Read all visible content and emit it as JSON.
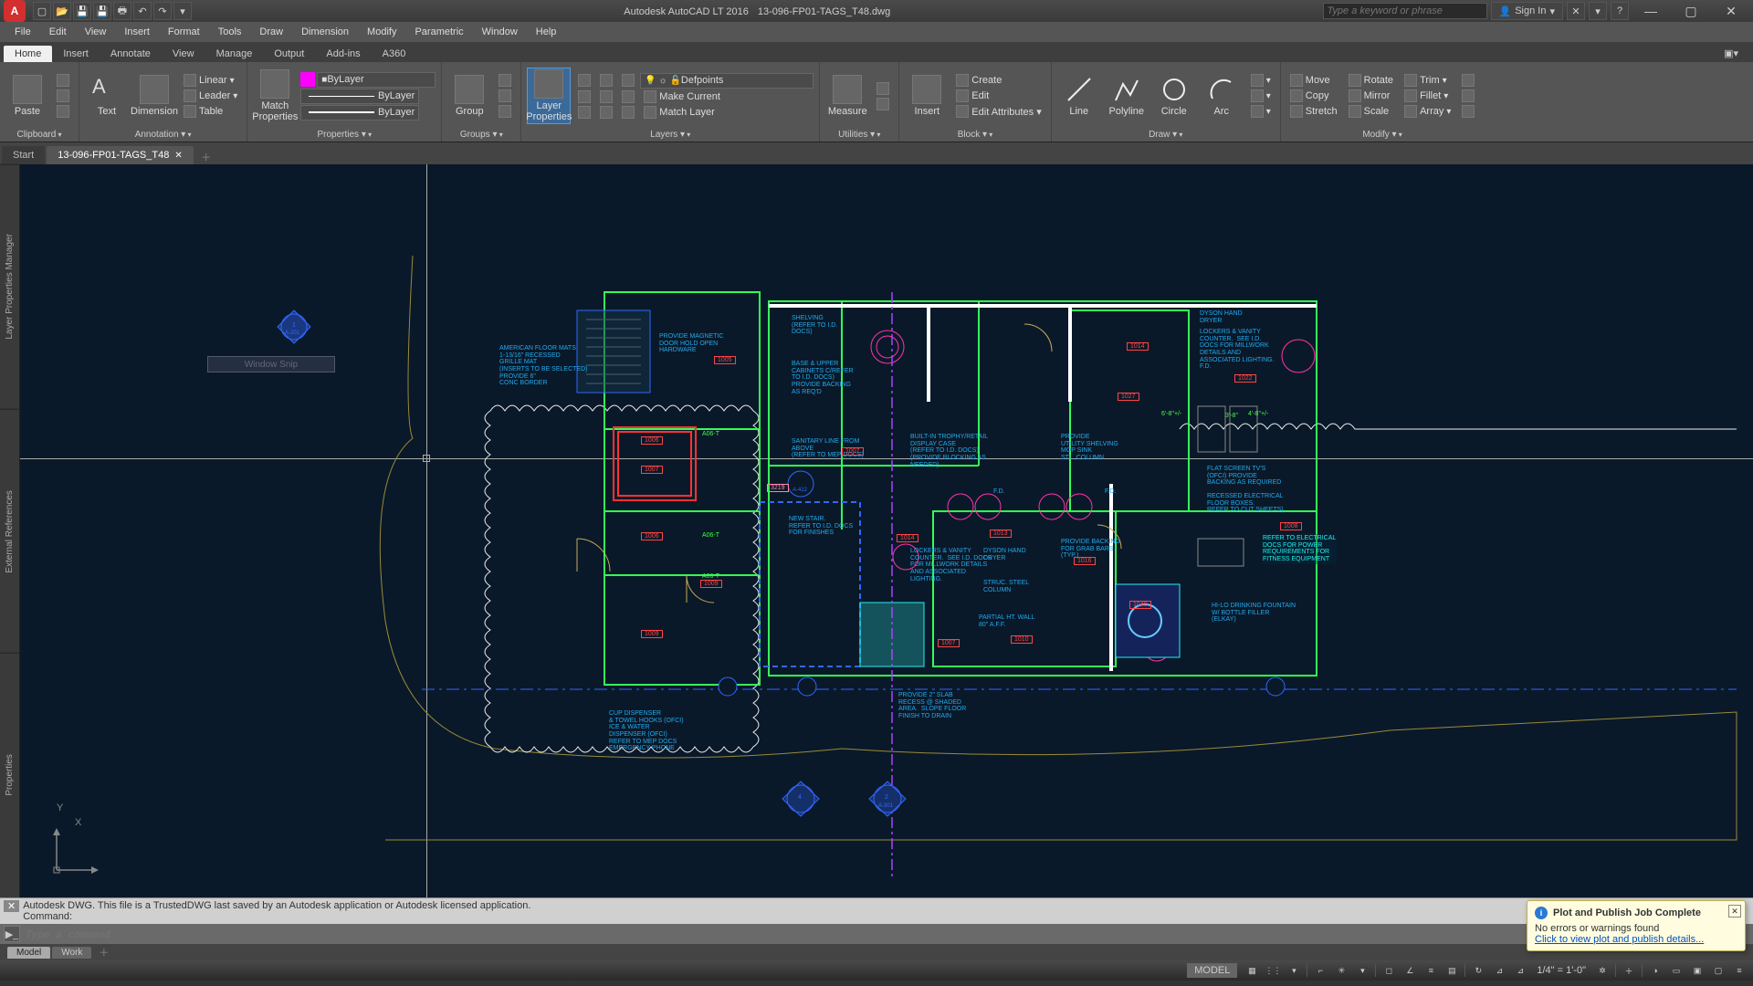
{
  "title": {
    "app": "Autodesk AutoCAD LT 2016",
    "file": "13-096-FP01-TAGS_T48.dwg"
  },
  "search": {
    "placeholder": "Type a keyword or phrase"
  },
  "signin": {
    "label": "Sign In"
  },
  "menus": [
    "File",
    "Edit",
    "View",
    "Insert",
    "Format",
    "Tools",
    "Draw",
    "Dimension",
    "Modify",
    "Parametric",
    "Window",
    "Help"
  ],
  "tabs": [
    "Home",
    "Insert",
    "Annotate",
    "View",
    "Manage",
    "Output",
    "Add-ins",
    "A360"
  ],
  "panels": {
    "clipboard": {
      "title": "Clipboard",
      "paste": "Paste"
    },
    "annotation": {
      "title": "Annotation ▾",
      "text": "Text",
      "dim": "Dimension",
      "linear": "Linear",
      "leader": "Leader",
      "table": "Table"
    },
    "props": {
      "title": "Properties ▾",
      "match": "Match\nProperties",
      "layer_sel": "ByLayer",
      "lt_sel": "ByLayer",
      "lw_sel": "ByLayer"
    },
    "groups": {
      "title": "Groups ▾",
      "group": "Group"
    },
    "layers": {
      "title": "Layers ▾",
      "layerprops": "Layer\nProperties",
      "current": "Defpoints",
      "makecur": "Make Current",
      "matchlayer": "Match Layer"
    },
    "utilities": {
      "title": "Utilities ▾",
      "measure": "Measure"
    },
    "block": {
      "title": "Block ▾",
      "insert": "Insert",
      "create": "Create",
      "edit": "Edit",
      "editattr": "Edit Attributes ▾"
    },
    "draw": {
      "title": "Draw ▾",
      "line": "Line",
      "polyline": "Polyline",
      "circle": "Circle",
      "arc": "Arc"
    },
    "modify": {
      "title": "Modify ▾",
      "move": "Move",
      "copy": "Copy",
      "stretch": "Stretch",
      "rotate": "Rotate",
      "mirror": "Mirror",
      "scale": "Scale",
      "trim": "Trim",
      "fillet": "Fillet",
      "array": "Array"
    }
  },
  "filetabs": {
    "start": "Start",
    "active": "13-096-FP01-TAGS_T48"
  },
  "side": [
    "Layer Properties Manager",
    "External References",
    "Properties"
  ],
  "snip": "Window Snip",
  "cmd": {
    "history": "Autodesk DWG.  This file is a TrustedDWG last saved by an Autodesk application or Autodesk licensed application.\nCommand:",
    "prompt": "Type a command"
  },
  "notify": {
    "title": "Plot and Publish Job Complete",
    "body": "No errors or warnings found",
    "link": "Click to view plot and publish details..."
  },
  "modeltabs": [
    "Model",
    "Work"
  ],
  "status": {
    "model": "MODEL",
    "scale": "1/4\" = 1'-0\""
  },
  "annotations": {
    "a1": "PROVIDE MAGNETIC\nDOOR HOLD OPEN\nHARDWARE",
    "a2": "AMERICAN FLOOR MATS\n1-13/16\" RECESSED\nGRILLE MAT\n(INSERTS TO BE SELECTED)\nPROVIDE 6\"\nCONC BORDER",
    "a3": "SHELVING\n(REFER TO I.D.\nDOCS)",
    "a4": "BASE & UPPER\nCABINETS C/REFER\nTO I.D. DOCS)\nPROVIDE BACKING\nAS REQ'D",
    "a5": "SANITARY LINE FROM\nABOVE\n(REFER TO MEP DOCS)",
    "a6": "BUILT-IN TROPHY/RETAIL\nDISPLAY CASE\n(REFER TO I.D. DOCS)\n(PROVIDE BLOCKING AS\nNEEDED)",
    "a7": "NEW STAIR.\nREFER TO I.D. DOCS\nFOR FINISHES",
    "a8": "CUP DISPENSER\n& TOWEL HOOKS (OFCI)\nICE & WATER\nDISPENSER (OFCI)\nREFER TO MEP DOCS\nEMERGENCY PHONE",
    "a9": "PROVIDE 2\" SLAB\nRECESS @ SHADED\nAREA.  SLOPE FLOOR\nFINISH TO DRAIN",
    "a10": "LOCKERS & VANITY\nCOUNTER.  SEE I.D. DOCS\nFOR MILLWORK DETAILS\nAND ASSOCIATED\nLIGHTING.",
    "a11": "DYSON HAND\nDRYER",
    "a12": "STRUC. STEEL\nCOLUMN",
    "a13": "PARTIAL HT. WALL\n80\" A.F.F.",
    "a14": "PROVIDE\nUTILITY SHELVING\nMOP SINK\nSTL. COLUMN",
    "a15": "PROVIDE BACKING\nFOR GRAB BARS\n(TYP.)",
    "a16": "DYSON HAND\nDRYER",
    "a17": "LOCKERS & VANITY\nCOUNTER.  SEE I.D.\nDOCS FOR MILLWORK\nDETAILS AND\nASSOCIATED LIGHTING.\nF.D.",
    "a18": "FLAT SCREEN TV'S\n(OFCI) PROVIDE\nBACKING AS REQUIRED",
    "a19": "RECESSED ELECTRICAL\nFLOOR BOXES.\nREFER TO CUT SHEETS)",
    "a20": "REFER TO ELECTRICAL\nDOCS FOR POWER\nREQUIREMENTS FOR\nFITNESS EQUIPMENT",
    "a21": "HI-LO DRINKING FOUNTAIN\nW/ BOTTLE FILLER\n(ELKAY)",
    "a22": "F.D.",
    "a23": "F.D.",
    "a24": "A-412",
    "a25": "4",
    "a26": "2",
    "a27": "A-301",
    "a28": "1",
    "a29": "A-201"
  },
  "roomtags": [
    "1005",
    "1006",
    "1007",
    "1006",
    "1009",
    "1009",
    "1007",
    "1007",
    "1013",
    "1014",
    "1010",
    "1016",
    "1014",
    "1027",
    "1022",
    "1008",
    "1040",
    "3219",
    "A06-T",
    "A06-T",
    "A06-T",
    "6'-8\"+/-",
    "4'-8\"+/-",
    "3'-8\""
  ]
}
